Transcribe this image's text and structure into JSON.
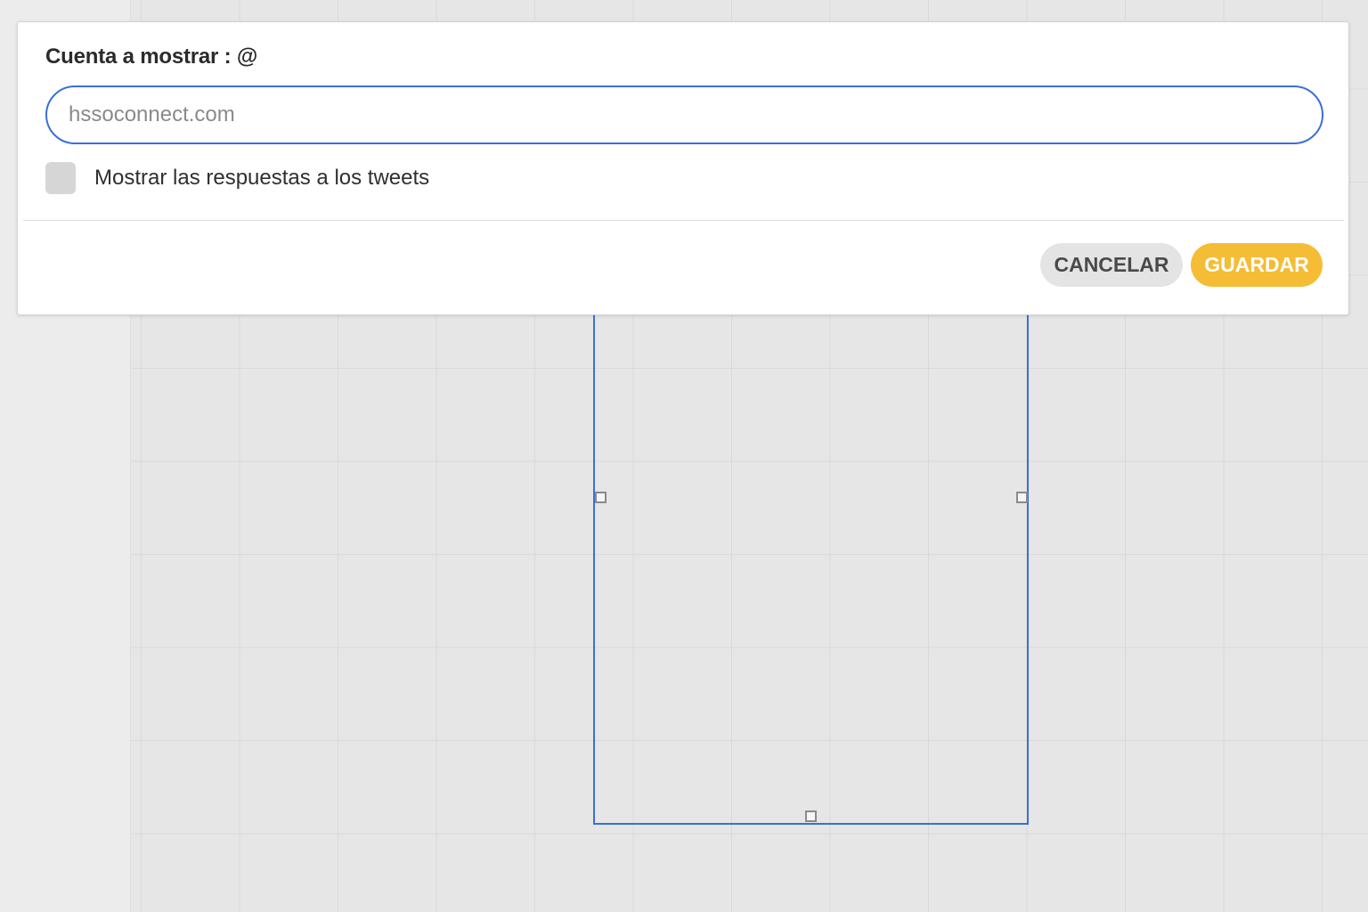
{
  "dialog": {
    "account_label": "Cuenta a mostrar : @",
    "account_placeholder": "hssoconnect.com",
    "account_value": "",
    "show_replies_label": "Mostrar las respuestas a los tweets",
    "show_replies_checked": false,
    "cancel_label": "CANCELAR",
    "save_label": "GUARDAR"
  },
  "colors": {
    "accent_blue": "#3b6fd8",
    "save_button": "#f4bd35",
    "cancel_button": "#e4e4e4"
  },
  "icons": {
    "resize_handle": "square-handle"
  }
}
